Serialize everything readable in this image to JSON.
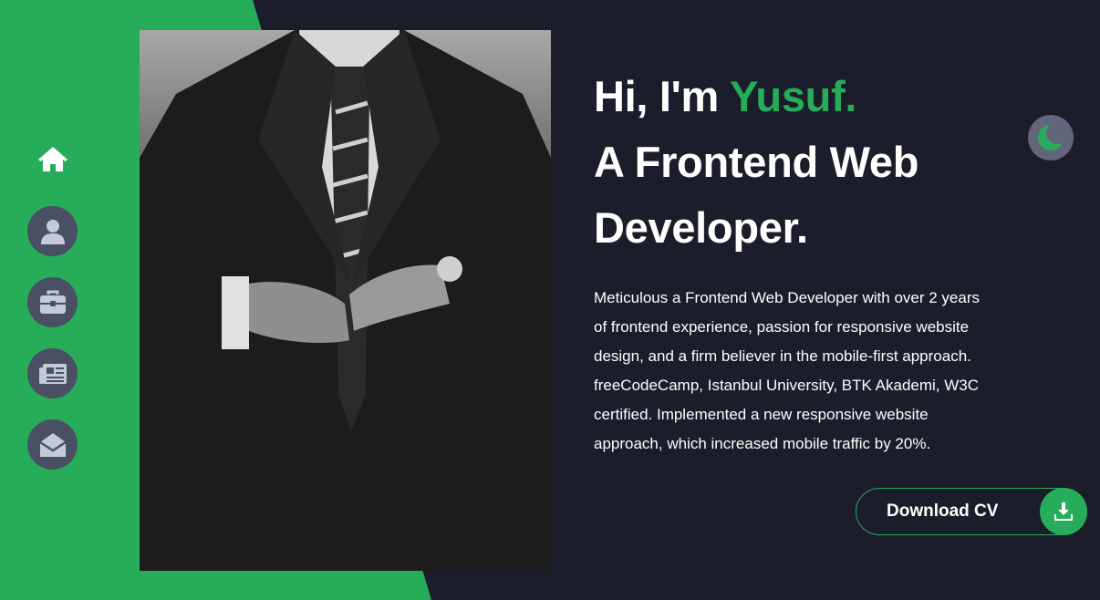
{
  "hero": {
    "greeting": "Hi, I'm ",
    "name": "Yusuf.",
    "role_line1": "A Frontend Web",
    "role_line2": "Developer.",
    "description": "Meticulous a Frontend Web Developer with over 2 years of frontend experience, passion for responsive website design, and a firm believer in the mobile-first approach. freeCodeCamp, Istanbul University, BTK Akademi, W3C certified. Implemented a new responsive website approach, which increased mobile traffic by 20%."
  },
  "download": {
    "label": "Download CV",
    "icon": "download-icon"
  },
  "nav": {
    "items": [
      {
        "icon": "home-icon",
        "active": true
      },
      {
        "icon": "user-icon",
        "active": false
      },
      {
        "icon": "briefcase-icon",
        "active": false
      },
      {
        "icon": "newspaper-icon",
        "active": false
      },
      {
        "icon": "envelope-open-icon",
        "active": false
      }
    ]
  },
  "theme_toggle": {
    "icon": "moon-icon"
  },
  "colors": {
    "accent": "#27ac5a",
    "background": "#1b1d2a",
    "nav_button": "#4a4f63"
  }
}
